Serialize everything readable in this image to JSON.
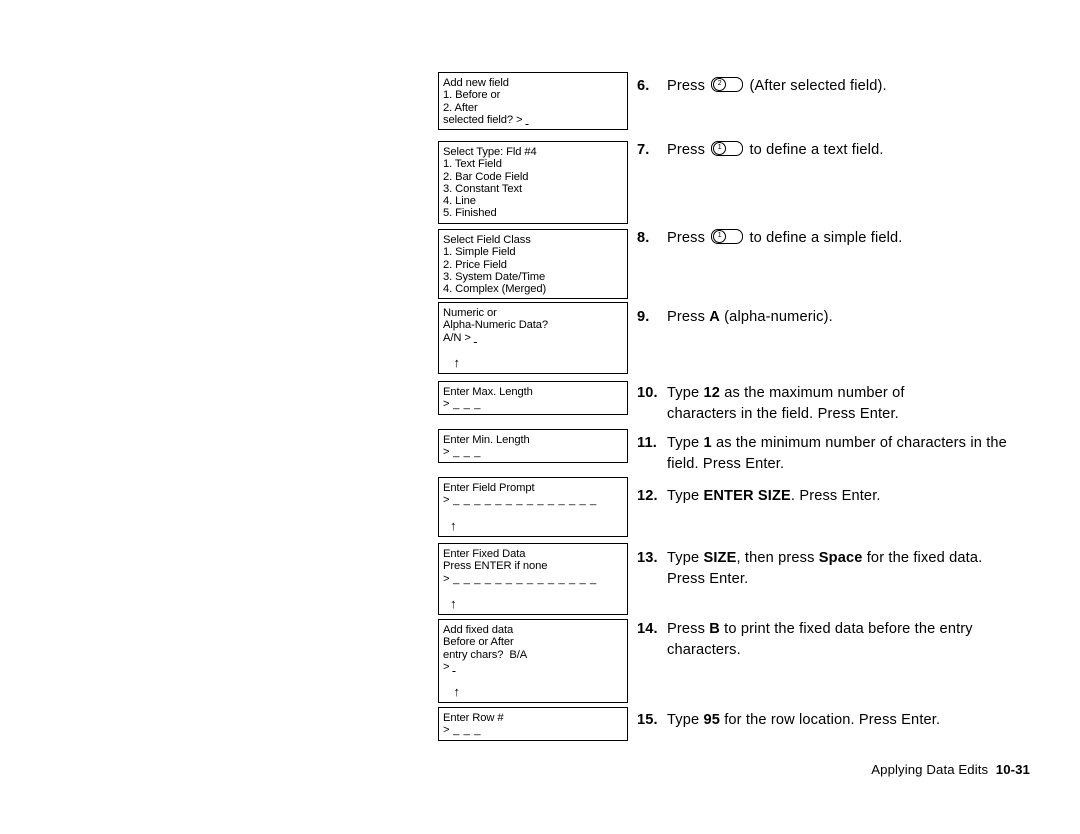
{
  "document": {
    "footer_text": "Applying Data Edits",
    "page_number": "10-31"
  },
  "displays": [
    {
      "name": "add-new-field",
      "lines": [
        "Add new field",
        "1. Before or",
        "2. After",
        "selected field? > "
      ],
      "cursor": "_",
      "arrow": false,
      "blank_after": 0
    },
    {
      "name": "select-type",
      "lines": [
        "Select Type: Fld #4",
        "1. Text Field",
        "2. Bar Code Field",
        "3. Constant Text",
        "4. Line",
        "5. Finished"
      ],
      "cursor": "",
      "arrow": false,
      "blank_after": 0
    },
    {
      "name": "select-field-class",
      "lines": [
        "Select Field Class",
        "1. Simple Field",
        "2. Price Field",
        "3. System Date/Time",
        "4. Complex (Merged)"
      ],
      "cursor": "",
      "arrow": false,
      "blank_after": 0
    },
    {
      "name": "numeric-or-alpha-numeric",
      "lines": [
        "Numeric or",
        "Alpha-Numeric Data?",
        "A/N > "
      ],
      "cursor": "_",
      "arrow": true,
      "arrow_indent": "   ",
      "blank_after": 0
    },
    {
      "name": "enter-max-length",
      "lines": [
        "Enter Max. Length",
        ">"
      ],
      "field_dashes": "_ _ _",
      "cursor": "",
      "arrow": false,
      "blank_after": 0
    },
    {
      "name": "enter-min-length",
      "lines": [
        "Enter Min. Length",
        ">"
      ],
      "field_dashes": "_ _ _",
      "cursor": "",
      "arrow": false,
      "blank_after": 0
    },
    {
      "name": "enter-field-prompt",
      "lines": [
        "Enter Field Prompt",
        ">"
      ],
      "field_dashes": "_ _ _ _ _ _ _ _ _ _ _ _ _ _",
      "cursor": "",
      "arrow": true,
      "arrow_indent": "  ",
      "blank_after": 0
    },
    {
      "name": "enter-fixed-data",
      "lines": [
        "Enter Fixed Data",
        "Press ENTER if none",
        ">"
      ],
      "field_dashes": "_ _ _ _ _ _ _ _ _ _ _ _ _ _",
      "cursor": "",
      "arrow": true,
      "arrow_indent": "  ",
      "blank_after": 0
    },
    {
      "name": "add-fixed-data",
      "lines": [
        "Add fixed data",
        "Before or After",
        "entry chars?  B/A",
        "> "
      ],
      "cursor": "_",
      "arrow": true,
      "arrow_indent": "   ",
      "blank_after": 0
    },
    {
      "name": "enter-row-number",
      "lines": [
        "Enter Row #",
        ">"
      ],
      "field_dashes": "_ _ _",
      "cursor": "",
      "arrow": false,
      "blank_after": 0
    }
  ],
  "steps": [
    {
      "number": "6.",
      "segments": [
        {
          "type": "text",
          "value": "Press "
        },
        {
          "type": "key",
          "value": "2"
        },
        {
          "type": "text",
          "value": " (After selected field)."
        }
      ]
    },
    {
      "number": "7.",
      "segments": [
        {
          "type": "text",
          "value": "Press "
        },
        {
          "type": "key",
          "value": "1"
        },
        {
          "type": "text",
          "value": " to define a text field."
        }
      ]
    },
    {
      "number": "8.",
      "segments": [
        {
          "type": "text",
          "value": "Press "
        },
        {
          "type": "key",
          "value": "1"
        },
        {
          "type": "text",
          "value": " to define a simple field."
        }
      ]
    },
    {
      "number": "9.",
      "segments": [
        {
          "type": "text",
          "value": "Press "
        },
        {
          "type": "bold",
          "value": "A"
        },
        {
          "type": "text",
          "value": " (alpha-numeric)."
        }
      ]
    },
    {
      "number": "10.",
      "segments": [
        {
          "type": "text",
          "value": "Type "
        },
        {
          "type": "bold",
          "value": "12"
        },
        {
          "type": "text",
          "value": " as the maximum number of characters in the field.  Press Enter."
        }
      ]
    },
    {
      "number": "11.",
      "segments": [
        {
          "type": "text",
          "value": "Type "
        },
        {
          "type": "bold",
          "value": "1"
        },
        {
          "type": "text",
          "value": " as the minimum number of characters in the field.  Press Enter."
        }
      ]
    },
    {
      "number": "12.",
      "segments": [
        {
          "type": "text",
          "value": "Type "
        },
        {
          "type": "bold",
          "value": "ENTER SIZE"
        },
        {
          "type": "text",
          "value": ".  Press Enter."
        }
      ]
    },
    {
      "number": "13.",
      "segments": [
        {
          "type": "text",
          "value": "Type "
        },
        {
          "type": "bold",
          "value": "SIZE"
        },
        {
          "type": "text",
          "value": ", then press "
        },
        {
          "type": "bold",
          "value": "Space"
        },
        {
          "type": "text",
          "value": " for the fixed data.  Press Enter."
        }
      ]
    },
    {
      "number": "14.",
      "segments": [
        {
          "type": "text",
          "value": "Press "
        },
        {
          "type": "bold",
          "value": "B"
        },
        {
          "type": "text",
          "value": " to print the fixed data before the entry characters."
        }
      ]
    },
    {
      "number": "15.",
      "segments": [
        {
          "type": "text",
          "value": "Type "
        },
        {
          "type": "bold",
          "value": "95"
        },
        {
          "type": "text",
          "value": " for the row location.  Press Enter."
        }
      ]
    }
  ],
  "layout": {
    "display_tops": [
      72,
      141,
      229,
      302,
      381,
      429,
      477,
      543,
      619,
      707
    ],
    "step_tops": [
      0,
      64,
      152,
      231,
      307,
      357,
      410,
      472,
      543,
      634
    ],
    "step_widths": [
      380,
      380,
      380,
      380,
      330,
      392,
      380,
      370,
      392,
      380
    ]
  }
}
